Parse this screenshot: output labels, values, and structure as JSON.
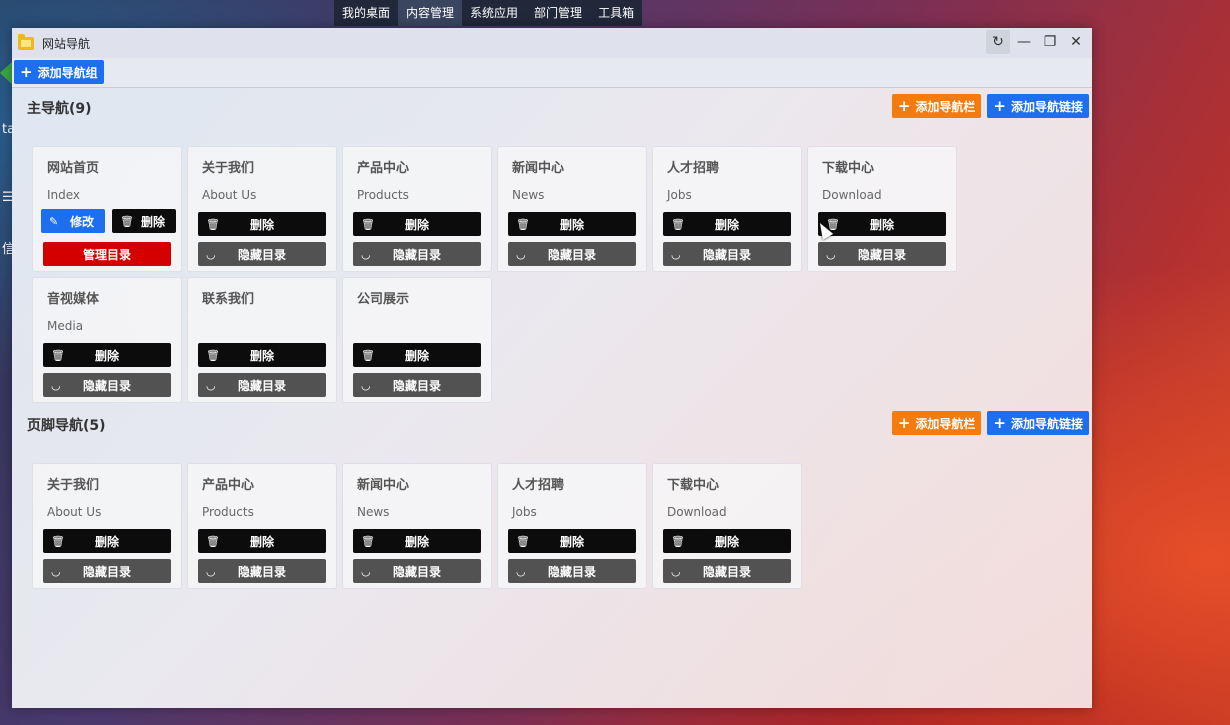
{
  "desktop": {
    "menu": [
      {
        "label": "我的桌面",
        "active": false
      },
      {
        "label": "内容管理",
        "active": true
      },
      {
        "label": "系统应用",
        "active": false
      },
      {
        "label": "部门管理",
        "active": false
      },
      {
        "label": "工具箱",
        "active": false
      }
    ],
    "left_peek": [
      "ta",
      "☰",
      "信"
    ]
  },
  "window": {
    "title": "网站导航",
    "controls": {
      "refresh": "↻",
      "minimize": "—",
      "restore": "❐",
      "close": "✕"
    }
  },
  "toolbar": {
    "add_group_label": "添加导航组"
  },
  "sections": [
    {
      "title": "主导航(9)",
      "add_bar_label": "添加导航栏",
      "add_link_label": "添加导航链接",
      "cards": [
        {
          "name": "网站首页",
          "en": "Index",
          "home": true,
          "edit_label": "修改",
          "delete_label": "删除",
          "manage_label": "管理目录"
        },
        {
          "name": "关于我们",
          "en": "About Us",
          "delete_label": "删除",
          "hide_label": "隐藏目录"
        },
        {
          "name": "产品中心",
          "en": "Products",
          "delete_label": "删除",
          "hide_label": "隐藏目录"
        },
        {
          "name": "新闻中心",
          "en": "News",
          "delete_label": "删除",
          "hide_label": "隐藏目录"
        },
        {
          "name": "人才招聘",
          "en": "Jobs",
          "delete_label": "删除",
          "hide_label": "隐藏目录"
        },
        {
          "name": "下载中心",
          "en": "Download",
          "delete_label": "删除",
          "hide_label": "隐藏目录"
        },
        {
          "name": "音视媒体",
          "en": "Media",
          "delete_label": "删除",
          "hide_label": "隐藏目录"
        },
        {
          "name": "联系我们",
          "en": "",
          "delete_label": "删除",
          "hide_label": "隐藏目录"
        },
        {
          "name": "公司展示",
          "en": "",
          "delete_label": "删除",
          "hide_label": "隐藏目录"
        }
      ]
    },
    {
      "title": "页脚导航(5)",
      "add_bar_label": "添加导航栏",
      "add_link_label": "添加导航链接",
      "cards": [
        {
          "name": "关于我们",
          "en": "About Us",
          "delete_label": "删除",
          "hide_label": "隐藏目录"
        },
        {
          "name": "产品中心",
          "en": "Products",
          "delete_label": "删除",
          "hide_label": "隐藏目录"
        },
        {
          "name": "新闻中心",
          "en": "News",
          "delete_label": "删除",
          "hide_label": "隐藏目录"
        },
        {
          "name": "人才招聘",
          "en": "Jobs",
          "delete_label": "删除",
          "hide_label": "隐藏目录"
        },
        {
          "name": "下载中心",
          "en": "Download",
          "delete_label": "删除",
          "hide_label": "隐藏目录"
        }
      ]
    }
  ],
  "icons": {
    "edit": "pencil-icon",
    "delete": "trash-icon",
    "hide": "collapse-icon",
    "plus": "plus-icon"
  },
  "colors": {
    "primary": "#1e6ff0",
    "warning": "#f57b0e",
    "danger": "#d40000",
    "dark": "#0c0c0c",
    "gray": "#525252"
  }
}
